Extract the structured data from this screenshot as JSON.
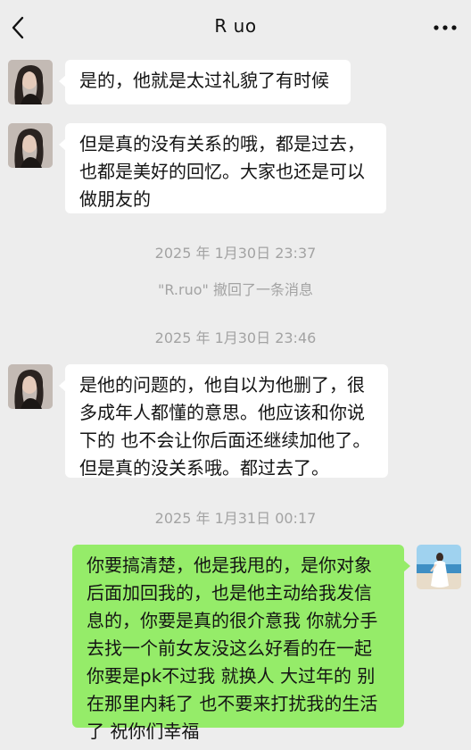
{
  "header": {
    "title": "R uo",
    "back_icon": "chevron-left-icon",
    "more_icon": "more-horizontal-icon"
  },
  "messages": [
    {
      "lines": [
        "是的，他就是太过礼貌了有时候"
      ]
    },
    {
      "lines": [
        "但是真的没有关系的哦，都是过去，",
        "也都是美好的回忆。大家也还是可以",
        "做朋友的"
      ]
    },
    {
      "lines": [
        "是他的问题的，他自以为他删了，很",
        "多成年人都懂的意思。他应该和你说",
        "下的 也不会让你后面还继续加他了。",
        "但是真的没关系哦。都过去了。"
      ]
    },
    {
      "lines": [
        "你要搞清楚，他是我甩的，是你对象",
        "后面加回我的，也是他主动给我发信",
        "息的，你要是真的很介意我 你就分手",
        "去找一个前女友没这么好看的在一起",
        "你要是pk不过我 就换人 大过年的 别",
        "在那里内耗了 也不要来打扰我的生活",
        "了 祝你们幸福"
      ]
    }
  ],
  "timestamps": [
    "2025 年 1月30日 23:37",
    "2025 年 1月30日 23:46",
    "2025 年 1月31日 00:17"
  ],
  "system": {
    "recall_text": "\"R.ruo\" 撤回了一条消息"
  },
  "colors": {
    "background": "#ededed",
    "incoming_bubble": "#ffffff",
    "outgoing_bubble": "#95ec69"
  }
}
